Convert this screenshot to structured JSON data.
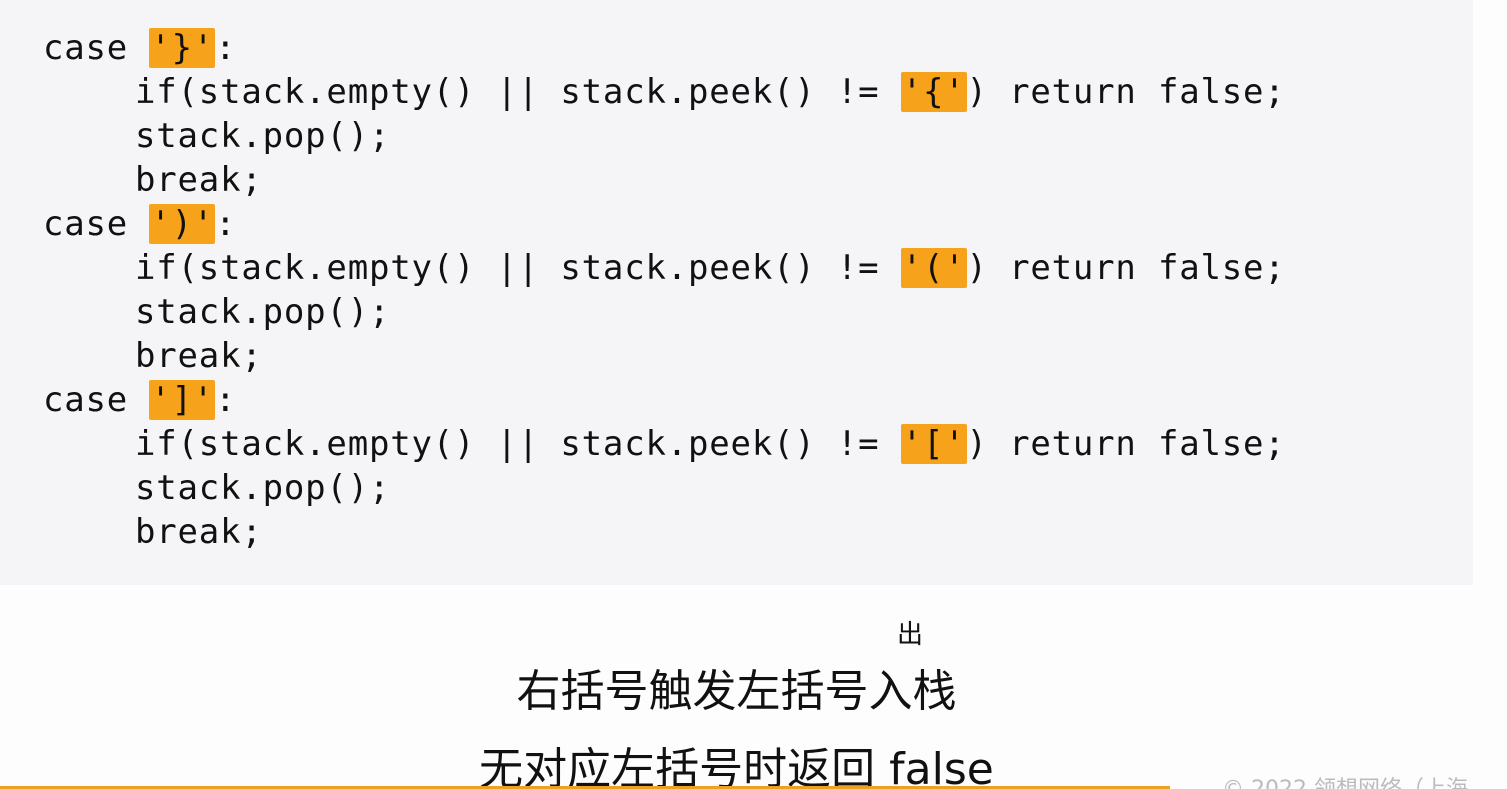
{
  "code_lines": [
    {
      "indent": false,
      "pre": "case ",
      "hl": "'}'",
      "post": ":"
    },
    {
      "indent": true,
      "pre": "if(stack.empty() || stack.peek() != ",
      "hl": "'{'",
      "post": ") return false;"
    },
    {
      "indent": true,
      "pre": "stack.pop();",
      "hl": "",
      "post": ""
    },
    {
      "indent": true,
      "pre": "break;",
      "hl": "",
      "post": ""
    },
    {
      "indent": false,
      "pre": "case ",
      "hl": "')'",
      "post": ":"
    },
    {
      "indent": true,
      "pre": "if(stack.empty() || stack.peek() != ",
      "hl": "'('",
      "post": ") return false;"
    },
    {
      "indent": true,
      "pre": "stack.pop();",
      "hl": "",
      "post": ""
    },
    {
      "indent": true,
      "pre": "break;",
      "hl": "",
      "post": ""
    },
    {
      "indent": false,
      "pre": "case ",
      "hl": "']'",
      "post": ":"
    },
    {
      "indent": true,
      "pre": "if(stack.empty() || stack.peek() != ",
      "hl": "'['",
      "post": ") return false;"
    },
    {
      "indent": true,
      "pre": "stack.pop();",
      "hl": "",
      "post": ""
    },
    {
      "indent": true,
      "pre": "break;",
      "hl": "",
      "post": ""
    }
  ],
  "annotation": "出",
  "caption_line1": "右括号触发左括号入栈",
  "caption_line2": "无对应左括号时返回 false",
  "footer": "© 2022 领想网络（上海",
  "colors": {
    "highlight": "#f7a21b",
    "code_bg": "#f5f5f7"
  }
}
